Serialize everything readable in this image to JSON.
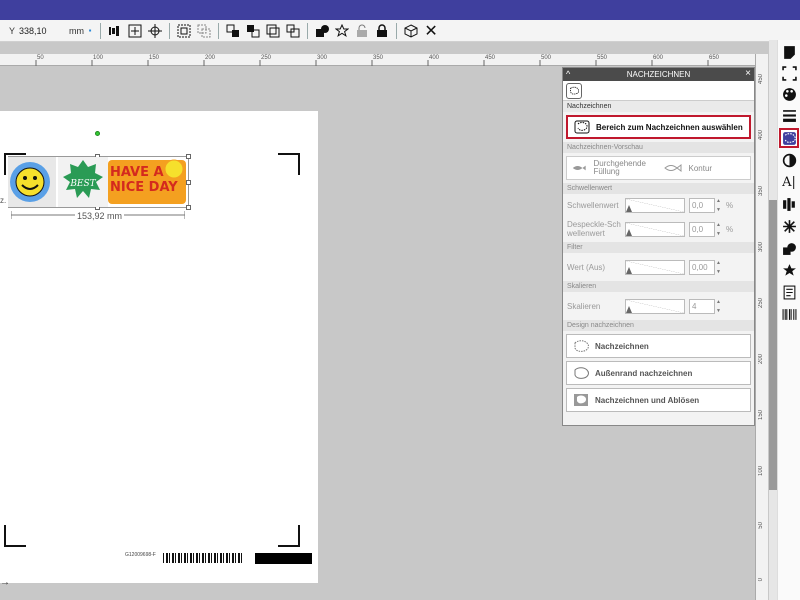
{
  "toolbar": {
    "y_label": "Y",
    "y_value": "338,10",
    "unit": "mm"
  },
  "ruler_top": {
    "ticks": [
      "50",
      "100",
      "150",
      "200",
      "250",
      "300",
      "350",
      "400",
      "450",
      "500",
      "550",
      "600",
      "650"
    ]
  },
  "ruler_right": {
    "ticks": [
      "450",
      "400",
      "350",
      "300",
      "250",
      "200",
      "150",
      "100",
      "50",
      "0"
    ]
  },
  "design": {
    "width_label": "153,92 mm",
    "height_label": "z.",
    "sticker_best": "BEST",
    "sticker_nice_day": "HAVE A NICE DAY"
  },
  "page": {
    "barcode_label": "G12009698-F"
  },
  "panel": {
    "title": "NACHZEICHNEN",
    "tab_label": "Nachzeichnen",
    "select_area_button": "Bereich zum Nachzeichnen auswählen",
    "preview_section": "Nachzeichnen-Vorschau",
    "preview_fill": "Durchgehende Füllung",
    "preview_outline": "Kontur",
    "threshold_section": "Schwellenwert",
    "threshold_label": "Schwellenwert",
    "threshold_value": "0,0",
    "threshold_unit": "%",
    "despeckle_label": "Despeckle-Schwellenwert",
    "despeckle_value": "0,0",
    "despeckle_unit": "%",
    "filter_section": "Filter",
    "filter_label": "Wert (Aus)",
    "filter_value": "0,00",
    "scale_section": "Skalieren",
    "scale_label": "Skalieren",
    "scale_value": "4",
    "design_section": "Design nachzeichnen",
    "trace_button": "Nachzeichnen",
    "trace_outer_button": "Außenrand nachzeichnen",
    "trace_detach_button": "Nachzeichnen und Ablösen"
  },
  "colors": {
    "accent": "#3f3f9e",
    "highlight": "#c0182d",
    "sticker_blue": "#5aa0e6",
    "sticker_yellow": "#f6e02c",
    "sticker_green": "#2a9b55",
    "sticker_orange": "#f4a020"
  }
}
